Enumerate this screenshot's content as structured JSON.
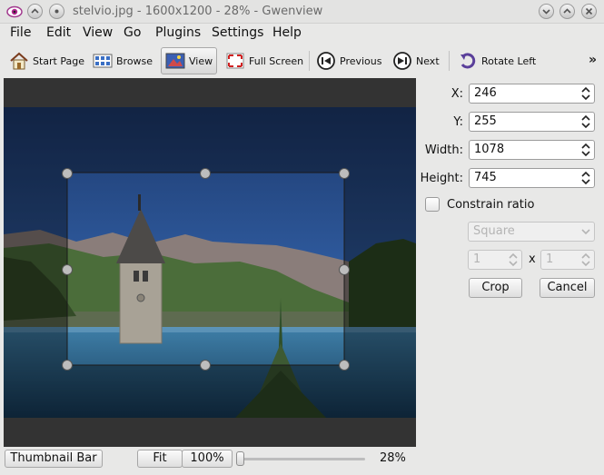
{
  "window": {
    "title": "stelvio.jpg - 1600x1200 - 28% - Gwenview"
  },
  "menu": [
    {
      "label": "File"
    },
    {
      "label": "Edit"
    },
    {
      "label": "View"
    },
    {
      "label": "Go"
    },
    {
      "label": "Plugins"
    },
    {
      "label": "Settings"
    },
    {
      "label": "Help"
    }
  ],
  "toolbar": {
    "start_page": "Start Page",
    "browse": "Browse",
    "view": "View",
    "full_screen": "Full Screen",
    "previous": "Previous",
    "next": "Next",
    "rotate_left": "Rotate Left",
    "overflow": "»"
  },
  "crop": {
    "x_label": "X:",
    "x_value": "246",
    "y_label": "Y:",
    "y_value": "255",
    "width_label": "Width:",
    "width_value": "1078",
    "height_label": "Height:",
    "height_value": "745",
    "constrain_label": "Constrain ratio",
    "ratio_select": "Square",
    "ratio_w": "1",
    "ratio_x": "x",
    "ratio_h": "1",
    "crop_button": "Crop",
    "cancel_button": "Cancel"
  },
  "status": {
    "thumbnail_bar": "Thumbnail Bar",
    "fit": "Fit",
    "zoom_100": "100%",
    "zoom_percent": "28%",
    "zoom_level": 0.28
  },
  "colors": {
    "selection_border": "#1a1a1a",
    "viewer_bg": "#333333"
  }
}
